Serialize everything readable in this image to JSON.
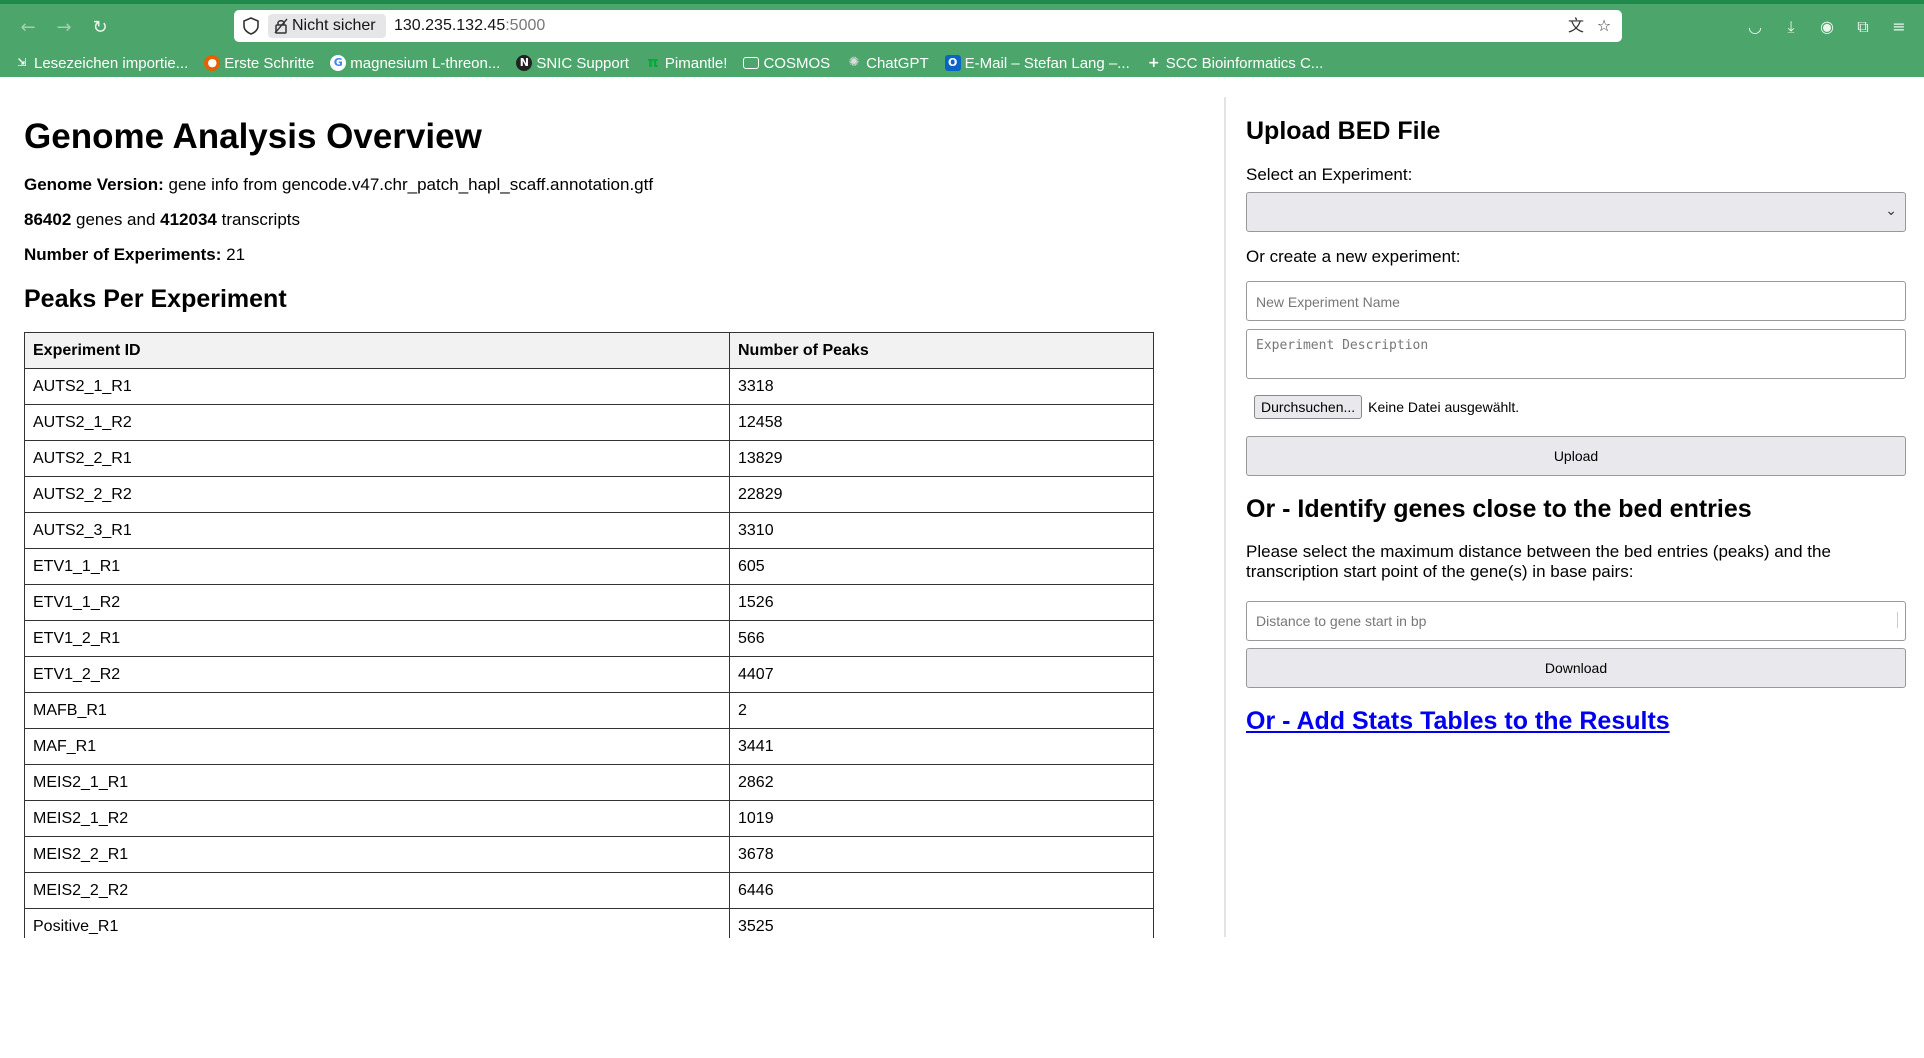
{
  "browser": {
    "address_host": "130.235.132.45",
    "address_port": ":5000",
    "not_secure_label": "Nicht sicher",
    "bookmarks": [
      {
        "label": "Lesezeichen importie...",
        "icon": "import-icon"
      },
      {
        "label": "Erste Schritte",
        "icon": "firefox-icon"
      },
      {
        "label": "magnesium L-threon...",
        "icon": "google-icon"
      },
      {
        "label": "SNIC Support",
        "icon": "snic-icon"
      },
      {
        "label": "Pimantle!",
        "icon": "pi-icon"
      },
      {
        "label": "COSMOS",
        "icon": "folder-icon"
      },
      {
        "label": "ChatGPT",
        "icon": "chatgpt-icon"
      },
      {
        "label": "E-Mail – Stefan Lang –...",
        "icon": "outlook-icon"
      },
      {
        "label": "SCC Bioinformatics C...",
        "icon": "plus-icon"
      }
    ]
  },
  "overview": {
    "title": "Genome Analysis Overview",
    "genome_version_label": "Genome Version:",
    "genome_version_value": " gene info from gencode.v47.chr_patch_hapl_scaff.annotation.gtf",
    "genes_count": "86402",
    "genes_text": " genes and ",
    "transcripts_count": "412034",
    "transcripts_text": " transcripts",
    "experiments_label": "Number of Experiments:",
    "experiments_value": " 21",
    "peaks_heading": "Peaks Per Experiment"
  },
  "table": {
    "headers": [
      "Experiment ID",
      "Number of Peaks"
    ],
    "rows": [
      [
        "AUTS2_1_R1",
        "3318"
      ],
      [
        "AUTS2_1_R2",
        "12458"
      ],
      [
        "AUTS2_2_R1",
        "13829"
      ],
      [
        "AUTS2_2_R2",
        "22829"
      ],
      [
        "AUTS2_3_R1",
        "3310"
      ],
      [
        "ETV1_1_R1",
        "605"
      ],
      [
        "ETV1_1_R2",
        "1526"
      ],
      [
        "ETV1_2_R1",
        "566"
      ],
      [
        "ETV1_2_R2",
        "4407"
      ],
      [
        "MAFB_R1",
        "2"
      ],
      [
        "MAF_R1",
        "3441"
      ],
      [
        "MEIS2_1_R1",
        "2862"
      ],
      [
        "MEIS2_1_R2",
        "1019"
      ],
      [
        "MEIS2_2_R1",
        "3678"
      ],
      [
        "MEIS2_2_R2",
        "6446"
      ],
      [
        "Positive_R1",
        "3525"
      ]
    ]
  },
  "upload": {
    "heading": "Upload BED File",
    "select_label": "Select an Experiment:",
    "select_value": "",
    "new_label": "Or create a new experiment:",
    "name_placeholder": "New Experiment Name",
    "description_placeholder": "Experiment Description",
    "browse_label": "Durchsuchen...",
    "no_file_label": "Keine Datei ausgewählt.",
    "upload_button": "Upload"
  },
  "identify": {
    "heading": "Or - Identify genes close to the bed entries",
    "description": "Please select the maximum distance between the bed entries (peaks) and the transcription start point of the gene(s) in base pairs:",
    "distance_placeholder": "Distance to gene start in bp",
    "download_button": "Download"
  },
  "stats_link": "Or - Add Stats Tables to the Results",
  "colors": {
    "chrome_green": "#4ca56a",
    "link_blue": "#0000ee"
  }
}
